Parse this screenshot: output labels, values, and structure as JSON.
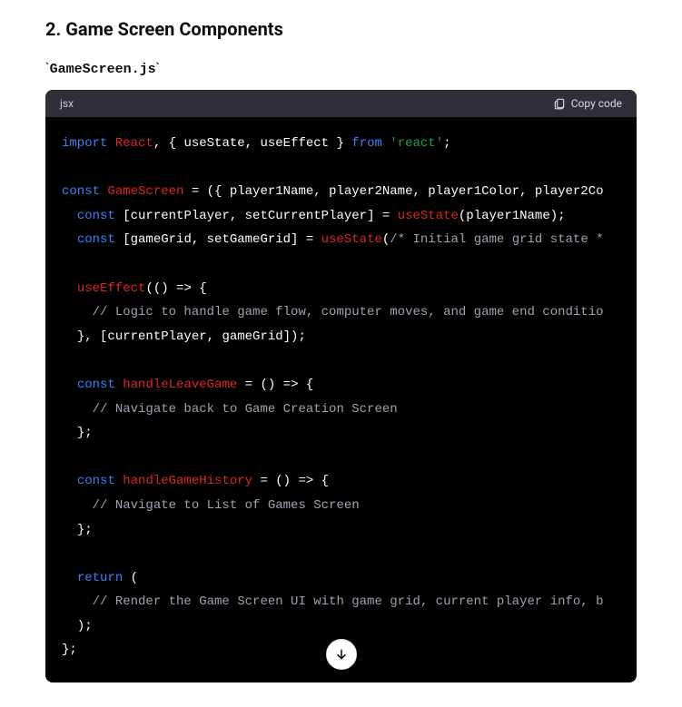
{
  "heading": "2. Game Screen Components",
  "filename": "GameScreen.js",
  "codeBlock": {
    "language": "jsx",
    "copyLabel": "Copy code"
  },
  "code": {
    "l1_import": "import",
    "l1_react": "React",
    "l1_mid1": ", { useState, useEffect } ",
    "l1_from": "from",
    "l1_space": " ",
    "l1_str": "'react'",
    "l1_semi": ";",
    "l3_const": "const",
    "l3_sp": " ",
    "l3_name": "GameScreen",
    "l3_rest": " = ({ player1Name, player2Name, player1Color, player2Co",
    "l4_indent": "  ",
    "l4_const": "const",
    "l4_mid": " [currentPlayer, setCurrentPlayer] = ",
    "l4_fn": "useState",
    "l4_args": "(player1Name);",
    "l5_indent": "  ",
    "l5_const": "const",
    "l5_mid": " [gameGrid, setGameGrid] = ",
    "l5_fn": "useState",
    "l5_open": "(",
    "l5_comment": "/* Initial game grid state *",
    "l7_indent": "  ",
    "l7_fn": "useEffect",
    "l7_rest": "(() => {",
    "l8_indent": "    ",
    "l8_comment": "// Logic to handle game flow, computer moves, and game end conditio",
    "l9_indent": "  ",
    "l9_text": "}, [currentPlayer, gameGrid]);",
    "l11_indent": "  ",
    "l11_const": "const",
    "l11_sp": " ",
    "l11_name": "handleLeaveGame",
    "l11_rest": " = () => {",
    "l12_indent": "    ",
    "l12_comment": "// Navigate back to Game Creation Screen",
    "l13_indent": "  ",
    "l13_text": "};",
    "l15_indent": "  ",
    "l15_const": "const",
    "l15_sp": " ",
    "l15_name": "handleGameHistory",
    "l15_rest": " = () => {",
    "l16_indent": "    ",
    "l16_comment": "// Navigate to List of Games Screen",
    "l17_indent": "  ",
    "l17_text": "};",
    "l19_indent": "  ",
    "l19_return": "return",
    "l19_rest": " (",
    "l20_indent": "    ",
    "l20_comment": "// Render the Game Screen UI with game grid, current player info, b",
    "l21_indent": "  ",
    "l21_text": ");",
    "l22_text": "};"
  }
}
